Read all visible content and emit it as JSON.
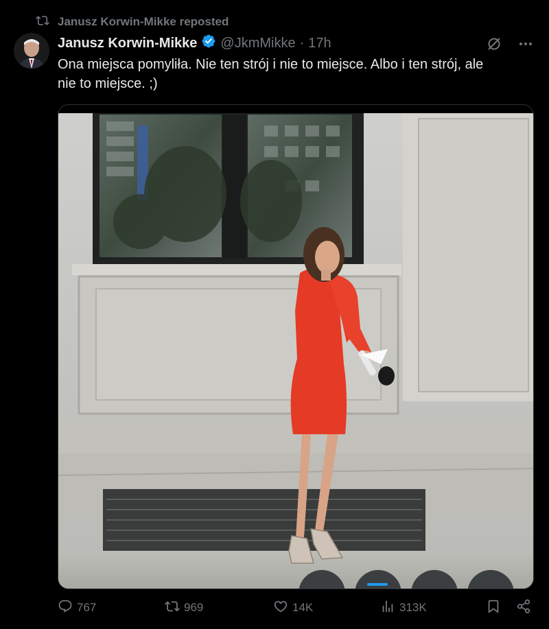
{
  "repost_banner": {
    "text": "Janusz Korwin-Mikke reposted",
    "icon": "repost-icon"
  },
  "author": {
    "display_name": "Janusz Korwin-Mikke",
    "handle": "@JkmMikke",
    "separator": "·",
    "time": "17h",
    "verified": true,
    "verified_color": "#1d9bf0"
  },
  "tweet": {
    "text": "Ona miejsca pomyliła. Nie ten strój i nie to miejsce. Albo i ten strój, ale\nnie to miejsce. ;)"
  },
  "media": {
    "type": "video",
    "description_icon": "video-frame"
  },
  "actions": {
    "reply_count": "767",
    "repost_count": "969",
    "like_count": "14K",
    "view_count": "313K"
  },
  "colors": {
    "background": "#000000",
    "text_primary": "#e7e9ea",
    "text_secondary": "#71767b",
    "accent": "#1d9bf0"
  }
}
